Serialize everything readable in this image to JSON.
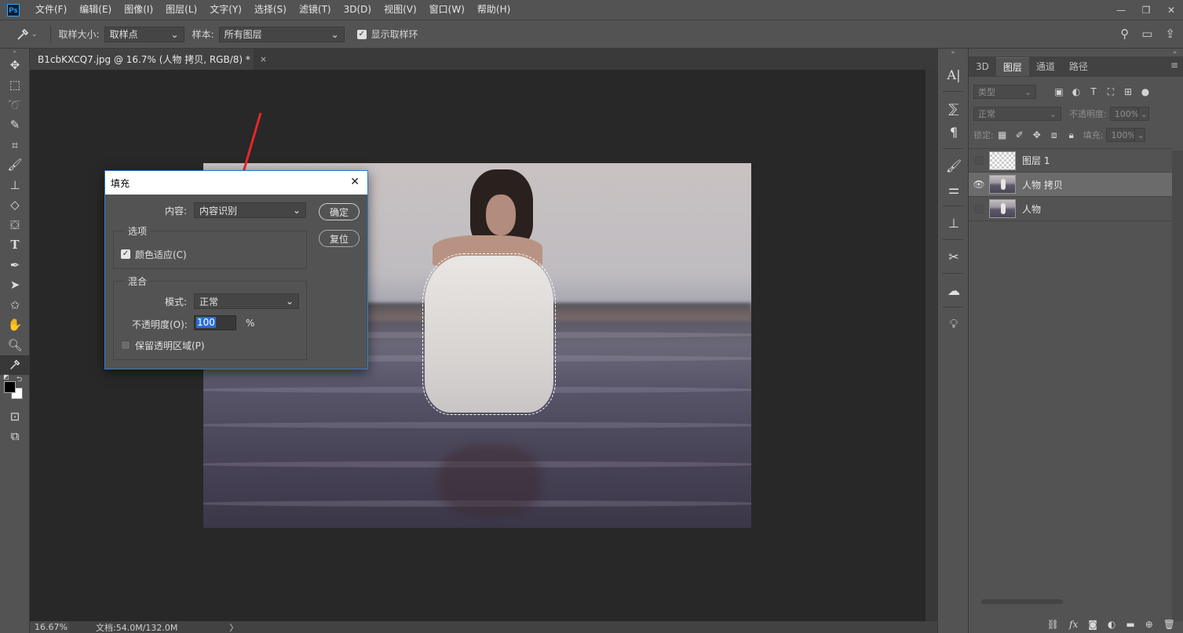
{
  "app": {
    "logo": "Ps"
  },
  "menu": [
    "文件(F)",
    "编辑(E)",
    "图像(I)",
    "图层(L)",
    "文字(Y)",
    "选择(S)",
    "滤镜(T)",
    "3D(D)",
    "视图(V)",
    "窗口(W)",
    "帮助(H)"
  ],
  "options": {
    "sample_size_label": "取样大小:",
    "sample_size_value": "取样点",
    "sample_label": "样本:",
    "sample_value": "所有图层",
    "show_ring_label": "显示取样环",
    "show_ring_checked": true
  },
  "document": {
    "tab_title": "B1cbKXCQ7.jpg @ 16.7% (人物 拷贝, RGB/8) *",
    "close": "×"
  },
  "dialog": {
    "title": "填充",
    "content_label": "内容:",
    "content_value": "内容识别",
    "ok": "确定",
    "reset": "复位",
    "options_group": "选项",
    "color_adapt": "颜色适应(C)",
    "color_adapt_checked": true,
    "blend_group": "混合",
    "mode_label": "模式:",
    "mode_value": "正常",
    "opacity_label": "不透明度(O):",
    "opacity_value": "100",
    "opacity_unit": "%",
    "preserve_label": "保留透明区域(P)",
    "preserve_checked": false
  },
  "panel": {
    "tabs": [
      "3D",
      "图层",
      "通道",
      "路径"
    ],
    "active_tab": "图层",
    "filter_placeholder": "类型",
    "blend_mode": "正常",
    "opacity_label": "不透明度:",
    "opacity_value": "100%",
    "lock_label": "锁定:",
    "fill_label": "填充:",
    "fill_value": "100%",
    "layers": [
      {
        "name": "图层 1",
        "visible": false,
        "selected": false,
        "thumb": "transparent"
      },
      {
        "name": "人物 拷贝",
        "visible": true,
        "selected": true,
        "thumb": "image"
      },
      {
        "name": "人物",
        "visible": false,
        "selected": false,
        "thumb": "image"
      }
    ]
  },
  "status": {
    "zoom": "16.67%",
    "doc": "文档:54.0M/132.0M",
    "arrow": "〉"
  },
  "colors": {
    "accent": "#2b7fd6",
    "arrow": "#e8262b",
    "foreground": "#000000",
    "background": "#ffffff"
  }
}
